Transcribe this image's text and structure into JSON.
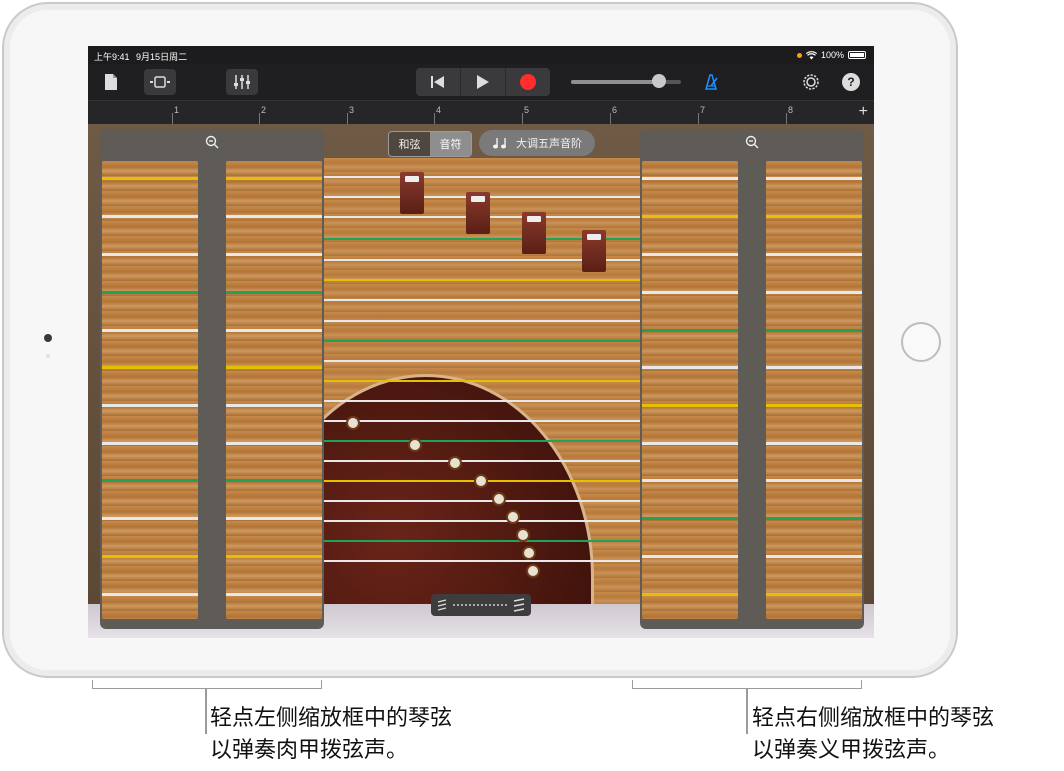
{
  "status_bar": {
    "time": "上午9:41",
    "date": "9月15日周二",
    "battery": "100%"
  },
  "toolbar": {
    "icons": [
      "document-icon",
      "view-toggle-icon",
      "mixer-icon",
      "rewind-icon",
      "play-icon",
      "record-icon",
      "metronome-icon",
      "settings-icon",
      "help-icon"
    ],
    "help_label": "?"
  },
  "volume": {
    "level": 0.8
  },
  "ruler": {
    "bars": [
      "1",
      "2",
      "3",
      "4",
      "5",
      "6",
      "7",
      "8"
    ],
    "add_label": "+"
  },
  "controls": {
    "segmented": [
      "和弦",
      "音符"
    ],
    "selected": "音符",
    "scale_label": "大调五声音阶"
  },
  "callouts": {
    "left": [
      "轻点左侧缩放框中的琴弦",
      "以弹奏肉甲拨弦声。"
    ],
    "right": [
      "轻点右侧缩放框中的琴弦",
      "以弹奏义甲拨弦声。"
    ]
  },
  "colors": {
    "string_white": "#e8e8e8",
    "string_yellow": "#e5c000",
    "string_green": "#1fa35a",
    "record": "#ff2d2d"
  }
}
